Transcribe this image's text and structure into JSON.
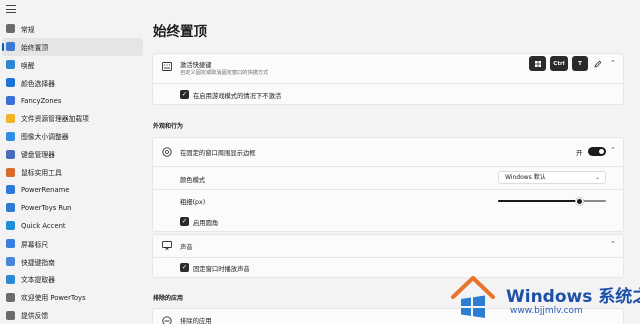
{
  "sidebar": {
    "items": [
      {
        "label": "常规",
        "icon": "gear-icon",
        "color": "#6b6b6b"
      },
      {
        "label": "始终置顶",
        "icon": "pin-icon",
        "color": "#3b7bd6",
        "active": true
      },
      {
        "label": "唤醒",
        "icon": "coffee-icon",
        "color": "#2d86d1"
      },
      {
        "label": "颜色选择器",
        "icon": "color-picker-icon",
        "color": "#1e73d8"
      },
      {
        "label": "FancyZones",
        "icon": "fancyzones-icon",
        "color": "#3a6fd8"
      },
      {
        "label": "文件资源管理器加载项",
        "icon": "file-explorer-icon",
        "color": "#f0b429"
      },
      {
        "label": "图像大小调整器",
        "icon": "image-resizer-icon",
        "color": "#2f8de4"
      },
      {
        "label": "键盘管理器",
        "icon": "keyboard-icon",
        "color": "#4b6cb7"
      },
      {
        "label": "鼠标实用工具",
        "icon": "mouse-icon",
        "color": "#d96a2b"
      },
      {
        "label": "PowerRename",
        "icon": "powerrename-icon",
        "color": "#2f7ad9"
      },
      {
        "label": "PowerToys Run",
        "icon": "powertoys-run-icon",
        "color": "#2e7bd0"
      },
      {
        "label": "Quick Accent",
        "icon": "quick-accent-icon",
        "color": "#1f8fd8"
      },
      {
        "label": "屏幕标尺",
        "icon": "ruler-icon",
        "color": "#3a7de0"
      },
      {
        "label": "快捷键指南",
        "icon": "shortcut-guide-icon",
        "color": "#4a86d8"
      },
      {
        "label": "文本提取器",
        "icon": "text-extractor-icon",
        "color": "#2a8ad6"
      },
      {
        "label": "欢迎使用 PowerToys",
        "icon": "powertoys-icon",
        "color": "#6b6b6b"
      },
      {
        "label": "提供反馈",
        "icon": "feedback-icon",
        "color": "#6b6b6b"
      }
    ]
  },
  "main": {
    "title": "始终置顶",
    "activation": {
      "title": "激活快捷键",
      "description": "自定义固定或取消固定窗口的快捷方式",
      "keys": [
        "⊞",
        "Ctrl",
        "T"
      ],
      "checkbox_label": "在启用游戏模式的情况下不激活",
      "checkbox_checked": true
    },
    "appearance_section": "外观和行为",
    "border": {
      "title": "在固定的窗口周围显示边框",
      "toggle_label": "开",
      "toggle_on": true,
      "color_mode_label": "颜色模式",
      "color_mode_value": "Windows 默认",
      "thickness_label": "粗细(px)",
      "thickness_value": 0.75,
      "rounded_label": "启用圆角",
      "rounded_checked": true
    },
    "sound": {
      "title": "声音",
      "checkbox_label": "固定窗口时播放声音",
      "checkbox_checked": true
    },
    "excluded_section": "排除的应用",
    "excluded_row_title": "排除的应用"
  },
  "watermark": {
    "brand": "Windows",
    "brand_cn": "系统之家",
    "url": "www.bjjmlv.com"
  }
}
